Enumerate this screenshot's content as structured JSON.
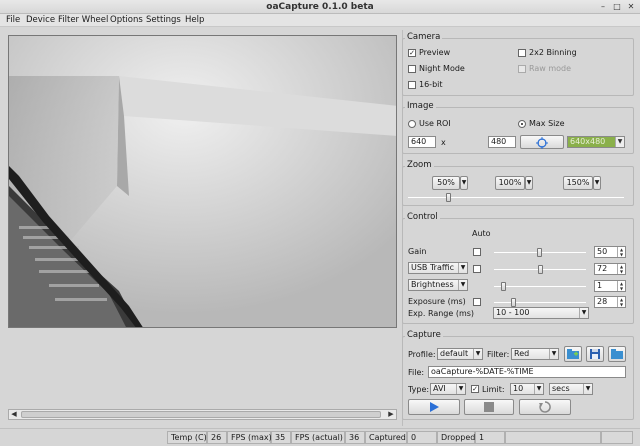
{
  "window": {
    "title": "oaCapture 0.1.0 beta"
  },
  "menu": [
    "File",
    "Device",
    "Filter Wheel",
    "Options",
    "Settings",
    "Help"
  ],
  "camera": {
    "title": "Camera",
    "preview": {
      "label": "Preview",
      "checked": true
    },
    "binning": {
      "label": "2x2 Binning",
      "checked": false
    },
    "night_mode": {
      "label": "Night Mode",
      "checked": false
    },
    "raw_mode": {
      "label": "Raw mode",
      "checked": false,
      "disabled": true
    },
    "bit16": {
      "label": "16-bit",
      "checked": false
    }
  },
  "image": {
    "title": "Image",
    "use_roi": "Use ROI",
    "max_size": "Max Size",
    "width": "640",
    "x_sep": "x",
    "height": "480",
    "resolution": "640x480"
  },
  "zoom": {
    "title": "Zoom",
    "buttons": [
      "50%",
      "100%",
      "150%"
    ],
    "slider_level": 0.18
  },
  "control": {
    "title": "Control",
    "auto_label": "Auto",
    "rows": [
      {
        "label": "Gain",
        "is_combo": false,
        "auto": true,
        "value": "50",
        "level": 0.49
      },
      {
        "label": "USB Traffic",
        "is_combo": true,
        "auto": true,
        "value": "72",
        "level": 0.51
      },
      {
        "label": "Brightness",
        "is_combo": true,
        "auto": false,
        "value": "1",
        "level": 0.08
      },
      {
        "label": "Exposure (ms)",
        "is_combo": false,
        "auto": true,
        "value": "28",
        "level": 0.2
      }
    ],
    "exp_range_label": "Exp. Range (ms)",
    "exp_range_value": "10 - 100"
  },
  "capture": {
    "title": "Capture",
    "profile_label": "Profile:",
    "profile_value": "default",
    "filter_label": "Filter:",
    "filter_value": "Red",
    "file_label": "File:",
    "file_value": "oaCapture-%DATE-%TIME",
    "type_label": "Type:",
    "type_value": "AVI",
    "limit_label": "Limit:",
    "limit_checked": true,
    "limit_value": "10",
    "limit_unit": "secs"
  },
  "status": {
    "temp_label": "Temp (C)",
    "temp_value": "26",
    "fps_max_label": "FPS (max)",
    "fps_max_value": "35",
    "fps_actual_label": "FPS (actual)",
    "fps_actual_value": "36",
    "captured_label": "Captured",
    "captured_value": "0",
    "dropped_label": "Dropped",
    "dropped_value": "1"
  },
  "colors": {
    "accent_combo": "#8ab04a",
    "play_blue": "#2a6fd6"
  }
}
